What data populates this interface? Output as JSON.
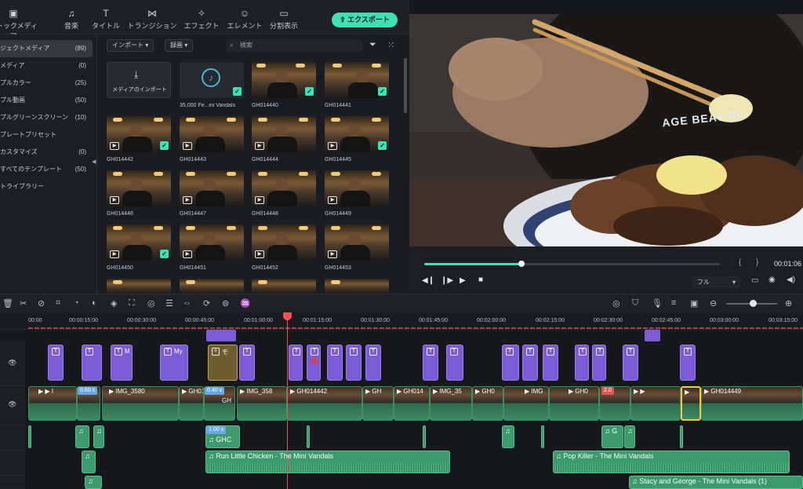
{
  "toolbar_tabs": [
    {
      "label": "ストックメディア",
      "icon": "stock-media-icon"
    },
    {
      "label": "音楽",
      "icon": "music-icon"
    },
    {
      "label": "タイトル",
      "icon": "title-icon"
    },
    {
      "label": "トランジション",
      "icon": "transition-icon"
    },
    {
      "label": "エフェクト",
      "icon": "effect-icon"
    },
    {
      "label": "エレメント",
      "icon": "element-icon"
    },
    {
      "label": "分割表示",
      "icon": "split-screen-icon"
    }
  ],
  "export_label": "エクスポート",
  "sidebar": {
    "items": [
      {
        "label": "ジェクトメディア",
        "count": "(89)"
      },
      {
        "label": "メディア",
        "count": "(0)"
      },
      {
        "label": "プルカラー",
        "count": "(25)"
      },
      {
        "label": "プル動画",
        "count": "(50)"
      },
      {
        "label": "プルグリーンスクリーン",
        "count": "(10)"
      },
      {
        "label": "プレートプリセット",
        "count": ""
      },
      {
        "label": "カスタマイズ",
        "count": "(0)"
      },
      {
        "label": "すべてのテンプレート",
        "count": "(50)"
      },
      {
        "label": "トライブラリー",
        "count": ""
      }
    ]
  },
  "media": {
    "import_dropdown": "インポート",
    "record_dropdown": "録画",
    "search_placeholder": "検索",
    "import_tile_label": "メディアのインポート",
    "items": [
      {
        "label": "35,000 Fe...ini Vandals"
      },
      {
        "label": "GH014440"
      },
      {
        "label": "GH014441"
      },
      {
        "label": "GH014442"
      },
      {
        "label": "GH014443"
      },
      {
        "label": "GH014444"
      },
      {
        "label": "GH014445"
      },
      {
        "label": "GH014446"
      },
      {
        "label": "GH014447"
      },
      {
        "label": "GH014448"
      },
      {
        "label": "GH014449"
      },
      {
        "label": "GH014450"
      },
      {
        "label": "GH014451"
      },
      {
        "label": "GH014452"
      },
      {
        "label": "GH014453"
      }
    ]
  },
  "preview": {
    "shirt_text": "AGE BEAT BA",
    "timecode": "00:01:06",
    "quality": "フル",
    "progress": 0.33
  },
  "timeline": {
    "ruler": [
      "00:00",
      "00:00:15:00",
      "00:00:30:00",
      "00:00:45:00",
      "00:01:00:00",
      "00:01:15:00",
      "00:01:30:00",
      "00:01:45:00",
      "00:02:00:00",
      "00:02:15:00",
      "00:02:30:00",
      "00:02:45:00",
      "00:03:00:00",
      "00:03:15:00"
    ],
    "title_clip_labels": {
      "m1": "M",
      "m2": "M",
      "my": "My",
      "mo": "モ"
    },
    "video_clips": [
      {
        "label": "0.60 x"
      },
      {
        "label": "IMG_3580"
      },
      {
        "label": "0.40 x"
      },
      {
        "label": "GH014"
      },
      {
        "label": "IMG_358"
      },
      {
        "label": "GH014442"
      },
      {
        "label": "GH"
      },
      {
        "label": "GH014"
      },
      {
        "label": "IMG_35"
      },
      {
        "label": "GH0"
      },
      {
        "label": "IMG"
      },
      {
        "label": "GH0"
      },
      {
        "label": "2.0"
      },
      {
        "label": "GH014449"
      }
    ],
    "clip_speed": "1.00 x",
    "small_labels": {
      "gh": "GH",
      "ghc": "GHC",
      "g": "G"
    },
    "audio_clips": [
      {
        "label": "Run Little Chicken - The Mini Vandals"
      },
      {
        "label": "Pop Killer - The Mini Vandals"
      },
      {
        "label": "Stacy and George - The Mini Vandals (1)"
      }
    ]
  }
}
